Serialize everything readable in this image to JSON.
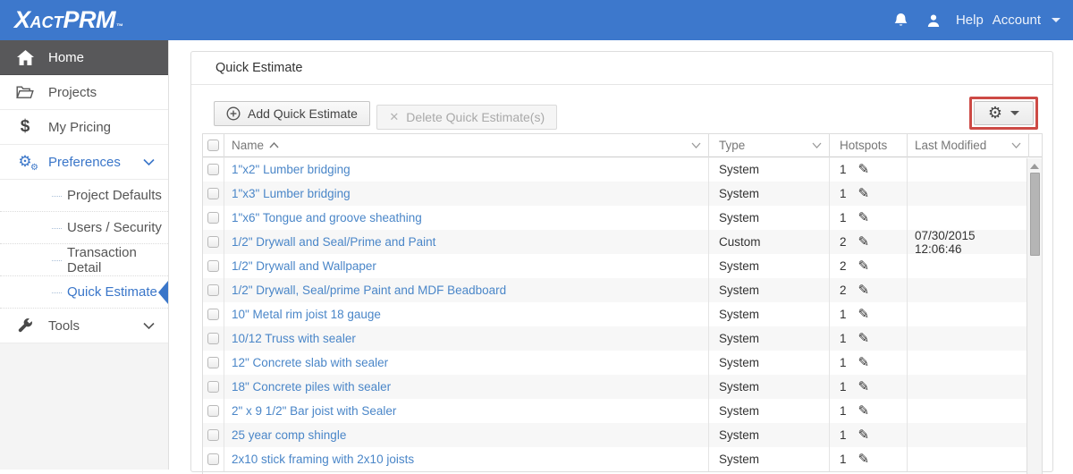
{
  "app": {
    "logo_part1": "X",
    "logo_part2": "ACT",
    "logo_part3": "PRM",
    "logo_tm": "™"
  },
  "topbar": {
    "help_label": "Help",
    "account_label": "Account"
  },
  "sidebar": {
    "items": [
      {
        "label": "Home"
      },
      {
        "label": "Projects"
      },
      {
        "label": "My Pricing"
      },
      {
        "label": "Preferences"
      }
    ],
    "subitems": [
      "Project Defaults",
      "Users / Security",
      "Transaction Detail",
      "Quick Estimate"
    ],
    "tools_label": "Tools"
  },
  "page": {
    "title": "Quick Estimate"
  },
  "toolbar": {
    "add_label": "Add Quick Estimate",
    "delete_label": "Delete Quick Estimate(s)"
  },
  "table": {
    "columns": [
      "Name",
      "Type",
      "Hotspots",
      "Last Modified"
    ],
    "rows": [
      {
        "name": "1\"x2\" Lumber bridging",
        "type": "System",
        "hotspots": "1",
        "last_modified": ""
      },
      {
        "name": "1\"x3\" Lumber bridging",
        "type": "System",
        "hotspots": "1",
        "last_modified": ""
      },
      {
        "name": "1\"x6\" Tongue and groove sheathing",
        "type": "System",
        "hotspots": "1",
        "last_modified": ""
      },
      {
        "name": "1/2\" Drywall and Seal/Prime and Paint",
        "type": "Custom",
        "hotspots": "2",
        "last_modified": "07/30/2015 12:06:46"
      },
      {
        "name": "1/2\" Drywall and Wallpaper",
        "type": "System",
        "hotspots": "2",
        "last_modified": ""
      },
      {
        "name": "1/2\" Drywall, Seal/prime Paint and MDF Beadboard",
        "type": "System",
        "hotspots": "2",
        "last_modified": ""
      },
      {
        "name": "10\" Metal rim joist 18 gauge",
        "type": "System",
        "hotspots": "1",
        "last_modified": ""
      },
      {
        "name": "10/12 Truss with sealer",
        "type": "System",
        "hotspots": "1",
        "last_modified": ""
      },
      {
        "name": "12\" Concrete slab with sealer",
        "type": "System",
        "hotspots": "1",
        "last_modified": ""
      },
      {
        "name": "18\" Concrete piles with sealer",
        "type": "System",
        "hotspots": "1",
        "last_modified": ""
      },
      {
        "name": "2\" x 9 1/2\" Bar joist with Sealer",
        "type": "System",
        "hotspots": "1",
        "last_modified": ""
      },
      {
        "name": "25 year comp shingle",
        "type": "System",
        "hotspots": "1",
        "last_modified": ""
      },
      {
        "name": "2x10 stick framing with 2x10 joists",
        "type": "System",
        "hotspots": "1",
        "last_modified": ""
      }
    ]
  },
  "colors": {
    "topbar_blue": "#3d78cc",
    "active_blue": "#3a76c9",
    "link_blue": "#4a86c8",
    "dark_item": "#58585a",
    "annotation_red": "#cd4a45",
    "row_stripe": "#f7f7f7"
  }
}
